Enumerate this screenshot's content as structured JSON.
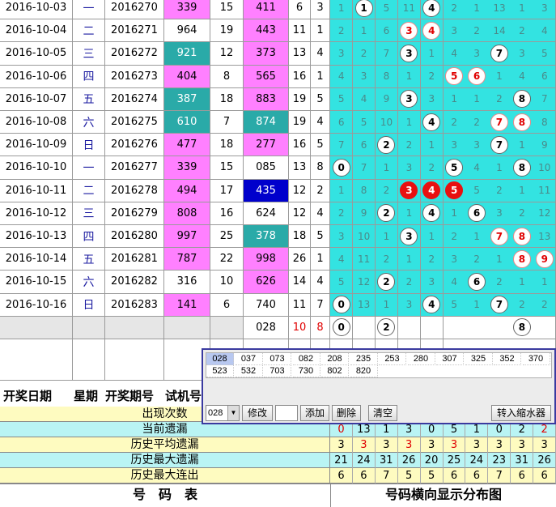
{
  "rows": [
    {
      "date": "2016-10-03",
      "week": "一",
      "issue": "2016270",
      "test": "339",
      "sum": "15",
      "lottery": "411",
      "span": "6",
      "k": "3",
      "test_style": "pink",
      "lottery_style": "pink",
      "dist": [
        "1",
        "B1",
        "5",
        "11",
        "B4",
        "2",
        "1",
        "13",
        "1",
        "3"
      ]
    },
    {
      "date": "2016-10-04",
      "week": "二",
      "issue": "2016271",
      "test": "964",
      "sum": "19",
      "lottery": "443",
      "span": "11",
      "k": "1",
      "test_style": "white",
      "lottery_style": "pink",
      "dist": [
        "2",
        "1",
        "6",
        "R3",
        "R4",
        "3",
        "2",
        "14",
        "2",
        "4"
      ]
    },
    {
      "date": "2016-10-05",
      "week": "三",
      "issue": "2016272",
      "test": "921",
      "sum": "12",
      "lottery": "373",
      "span": "13",
      "k": "4",
      "test_style": "teal",
      "lottery_style": "pink",
      "dist": [
        "3",
        "2",
        "7",
        "B3",
        "1",
        "4",
        "3",
        "B7",
        "3",
        "5"
      ]
    },
    {
      "date": "2016-10-06",
      "week": "四",
      "issue": "2016273",
      "test": "404",
      "sum": "8",
      "lottery": "565",
      "span": "16",
      "k": "1",
      "test_style": "pink",
      "lottery_style": "pink",
      "dist": [
        "4",
        "3",
        "8",
        "1",
        "2",
        "R5",
        "R6",
        "1",
        "4",
        "6"
      ]
    },
    {
      "date": "2016-10-07",
      "week": "五",
      "issue": "2016274",
      "test": "387",
      "sum": "18",
      "lottery": "883",
      "span": "19",
      "k": "5",
      "test_style": "teal",
      "lottery_style": "pink",
      "dist": [
        "5",
        "4",
        "9",
        "B3",
        "3",
        "1",
        "1",
        "2",
        "B8",
        "7"
      ]
    },
    {
      "date": "2016-10-08",
      "week": "六",
      "issue": "2016275",
      "test": "610",
      "sum": "7",
      "lottery": "874",
      "span": "19",
      "k": "4",
      "test_style": "teal",
      "lottery_style": "teal",
      "dist": [
        "6",
        "5",
        "10",
        "1",
        "B4",
        "2",
        "2",
        "R7",
        "R8",
        "8"
      ]
    },
    {
      "date": "2016-10-09",
      "week": "日",
      "issue": "2016276",
      "test": "477",
      "sum": "18",
      "lottery": "277",
      "span": "16",
      "k": "5",
      "test_style": "pink",
      "lottery_style": "pink",
      "dist": [
        "7",
        "6",
        "B2",
        "2",
        "1",
        "3",
        "3",
        "B7",
        "1",
        "9"
      ]
    },
    {
      "date": "2016-10-10",
      "week": "一",
      "issue": "2016277",
      "test": "339",
      "sum": "15",
      "lottery": "085",
      "span": "13",
      "k": "8",
      "test_style": "pink",
      "lottery_style": "white",
      "dist": [
        "B0",
        "7",
        "1",
        "3",
        "2",
        "B5",
        "4",
        "1",
        "B8",
        "10"
      ]
    },
    {
      "date": "2016-10-11",
      "week": "二",
      "issue": "2016278",
      "test": "494",
      "sum": "17",
      "lottery": "435",
      "span": "12",
      "k": "2",
      "test_style": "pink",
      "lottery_style": "blue",
      "dist": [
        "1",
        "8",
        "2",
        "S3",
        "S4",
        "S5",
        "5",
        "2",
        "1",
        "11"
      ]
    },
    {
      "date": "2016-10-12",
      "week": "三",
      "issue": "2016279",
      "test": "808",
      "sum": "16",
      "lottery": "624",
      "span": "12",
      "k": "4",
      "test_style": "pink",
      "lottery_style": "white",
      "dist": [
        "2",
        "9",
        "B2",
        "1",
        "B4",
        "1",
        "B6",
        "3",
        "2",
        "12"
      ]
    },
    {
      "date": "2016-10-13",
      "week": "四",
      "issue": "2016280",
      "test": "997",
      "sum": "25",
      "lottery": "378",
      "span": "18",
      "k": "5",
      "test_style": "pink",
      "lottery_style": "teal",
      "dist": [
        "3",
        "10",
        "1",
        "B3",
        "1",
        "2",
        "1",
        "R7",
        "R8",
        "13"
      ]
    },
    {
      "date": "2016-10-14",
      "week": "五",
      "issue": "2016281",
      "test": "787",
      "sum": "22",
      "lottery": "998",
      "span": "26",
      "k": "1",
      "test_style": "pink",
      "lottery_style": "pink",
      "dist": [
        "4",
        "11",
        "2",
        "1",
        "2",
        "3",
        "2",
        "1",
        "R8",
        "R9"
      ]
    },
    {
      "date": "2016-10-15",
      "week": "六",
      "issue": "2016282",
      "test": "316",
      "sum": "10",
      "lottery": "626",
      "span": "14",
      "k": "4",
      "test_style": "white",
      "lottery_style": "pink",
      "dist": [
        "5",
        "12",
        "B2",
        "2",
        "3",
        "4",
        "B6",
        "2",
        "1",
        "1"
      ]
    },
    {
      "date": "2016-10-16",
      "week": "日",
      "issue": "2016283",
      "test": "141",
      "sum": "6",
      "lottery": "740",
      "span": "11",
      "k": "7",
      "test_style": "pink",
      "lottery_style": "white",
      "dist": [
        "B0",
        "13",
        "1",
        "3",
        "B4",
        "5",
        "1",
        "B7",
        "2",
        "2"
      ]
    }
  ],
  "prediction": {
    "lottery": "028",
    "span": "10",
    "k": "8",
    "dist": [
      "B0",
      "",
      "B2",
      "",
      "",
      "",
      "",
      "",
      "B8",
      ""
    ]
  },
  "headers": {
    "date": "开奖日期",
    "week": "星期",
    "issue": "开奖期号",
    "test": "试机号"
  },
  "stats": {
    "appear": {
      "label": "出现次数",
      "values": []
    },
    "current_miss": {
      "label": "当前遗漏",
      "values": [
        "0",
        "13",
        "1",
        "3",
        "0",
        "5",
        "1",
        "0",
        "2",
        "2"
      ]
    },
    "avg_miss": {
      "label": "历史平均遗漏",
      "values": [
        "3",
        "3",
        "3",
        "3",
        "3",
        "3",
        "3",
        "3",
        "3",
        "3"
      ]
    },
    "max_miss": {
      "label": "历史最大遗漏",
      "values": [
        "21",
        "24",
        "31",
        "26",
        "20",
        "25",
        "24",
        "23",
        "31",
        "26"
      ]
    },
    "max_streak": {
      "label": "历史最大连出",
      "values": [
        "6",
        "6",
        "7",
        "5",
        "5",
        "6",
        "6",
        "7",
        "6",
        "6"
      ]
    }
  },
  "footer": {
    "left": "号　码　表",
    "right": "号码横向显示分布图"
  },
  "popup": {
    "numbers": [
      "028",
      "037",
      "073",
      "082",
      "208",
      "235",
      "253",
      "280",
      "307",
      "325",
      "352",
      "370",
      "523",
      "532",
      "703",
      "730",
      "802",
      "820"
    ],
    "selected": "028",
    "combo_value": "028",
    "buttons": {
      "modify": "修改",
      "add": "添加",
      "delete": "删除",
      "clear": "清空",
      "transfer": "转入缩水器"
    }
  },
  "colors": {
    "pink": "#ff80ff",
    "teal": "#2aaaa8",
    "blue": "#0000cc",
    "cyan": "#33e3e1",
    "red": "#e81010",
    "yellow": "#fefbc0"
  }
}
